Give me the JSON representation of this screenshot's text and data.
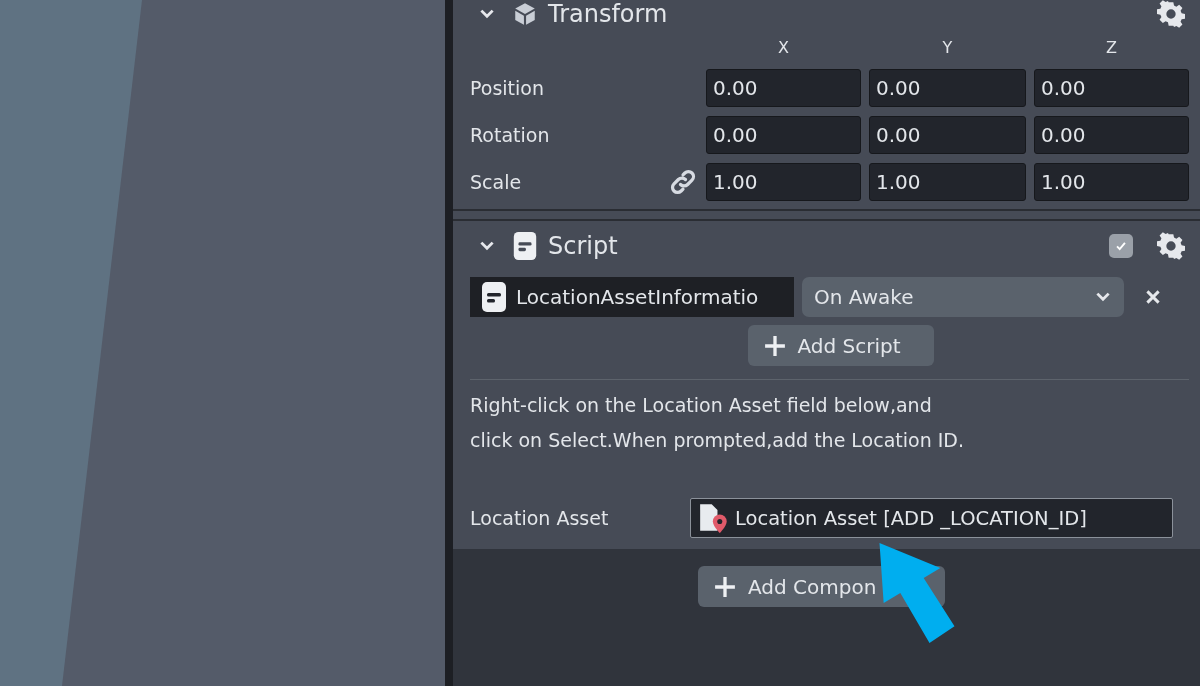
{
  "transform": {
    "title": "Transform",
    "expanded": true,
    "axes": [
      "X",
      "Y",
      "Z"
    ],
    "rows": [
      {
        "label": "Position",
        "values": [
          "0.00",
          "0.00",
          "0.00"
        ]
      },
      {
        "label": "Rotation",
        "values": [
          "0.00",
          "0.00",
          "0.00"
        ]
      },
      {
        "label": "Scale",
        "values": [
          "1.00",
          "1.00",
          "1.00"
        ]
      }
    ]
  },
  "script": {
    "title": "Script",
    "expanded": true,
    "enabled": true,
    "script_name": "LocationAssetInformatio",
    "event": "On Awake",
    "add_script": "Add Script",
    "description": "Right-click on the Location Asset field below,and click on Select.When prompted,add the Location ID.",
    "asset_label": "Location Asset",
    "asset_value": "Location Asset [ADD _LOCATION_ID]"
  },
  "add_component": "Add Compon"
}
